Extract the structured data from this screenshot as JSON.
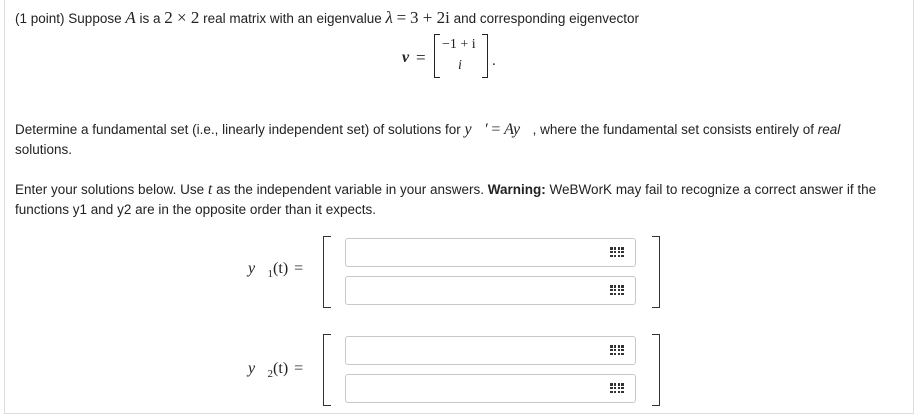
{
  "problem": {
    "points": "(1 point)",
    "intro_a": "Suppose",
    "matrix_name": "A",
    "intro_b": "is a",
    "dim": "2 × 2",
    "intro_c": "real matrix with an eigenvalue",
    "lambda": "λ",
    "equals": "=",
    "eigenvalue": "3 + 2i",
    "intro_d": "and corresponding eigenvector"
  },
  "eigenvector": {
    "label": "v⃗",
    "equals": "=",
    "entry1": "−1 + i",
    "entry2": "i",
    "period": "."
  },
  "task": {
    "t1": "Determine a fundamental set (i.e., linearly independent set) of solutions for",
    "ode_lhs": "y⃗′",
    "ode_eq": "=",
    "ode_rhs": "Ay⃗",
    "t2": ", where the fundamental set consists entirely of",
    "t3": "real",
    "t4": "solutions."
  },
  "instructions": {
    "t1": "Enter your solutions below. Use",
    "var": "t",
    "t2": "as the independent variable in your answers.",
    "warning_label": "Warning:",
    "t3": "WeBWorK may fail to recognize a correct answer if the functions y1 and y2 are in the opposite order than it expects."
  },
  "answers": {
    "y1_label": "y⃗",
    "y1_sub": "1",
    "y1_arg": "(t)",
    "y2_label": "y⃗",
    "y2_sub": "2",
    "y2_arg": "(t)",
    "equals": "=",
    "y1_top_value": "",
    "y1_bottom_value": "",
    "y2_top_value": "",
    "y2_bottom_value": ""
  },
  "icons": {
    "equation_editor": "keyboard-grid-icon"
  },
  "colors": {
    "text": "#222222",
    "field_border": "#c8c8c8",
    "frame_border": "#dcdcdc"
  }
}
